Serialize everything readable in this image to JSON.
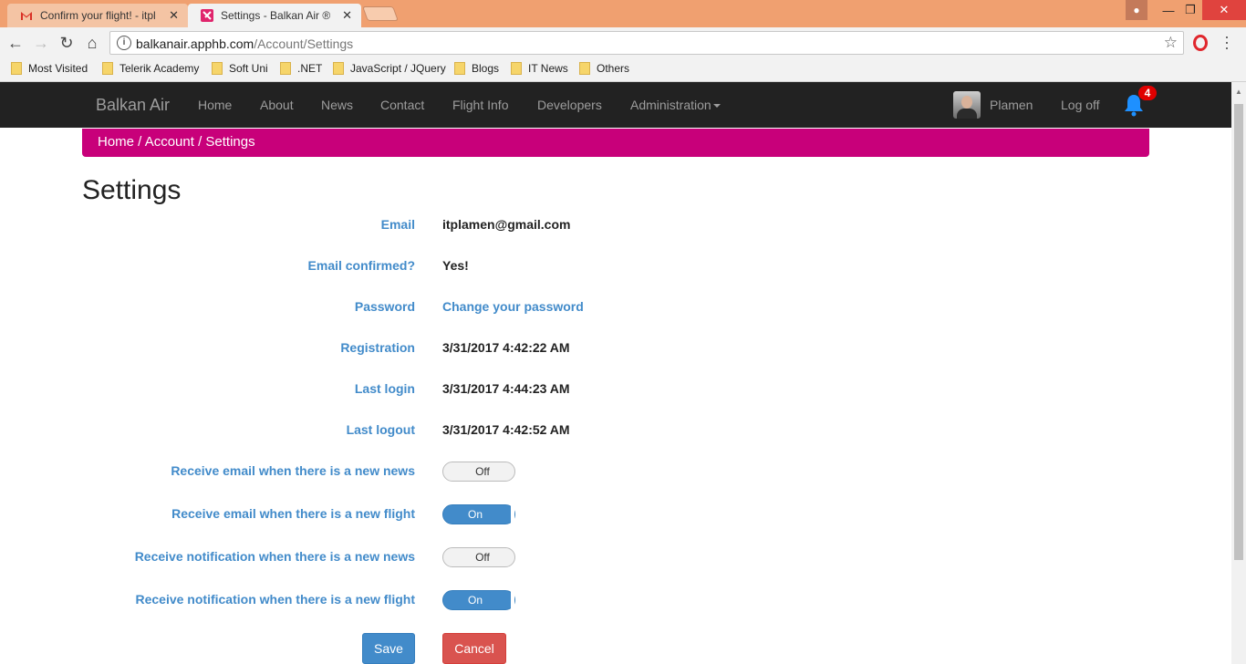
{
  "browser": {
    "tabs": [
      {
        "title": "Confirm your flight! - itpl",
        "active": false
      },
      {
        "title": "Settings - Balkan Air ®",
        "active": true
      }
    ],
    "url_host": "balkanair.apphb.com",
    "url_path": "/Account/Settings",
    "bookmarks": [
      "Most Visited",
      "Telerik Academy",
      "Soft Uni",
      ".NET",
      "JavaScript / JQuery",
      "Blogs",
      "IT News",
      "Others"
    ]
  },
  "navbar": {
    "brand": "Balkan Air",
    "links": [
      "Home",
      "About",
      "News",
      "Contact",
      "Flight Info",
      "Developers",
      "Administration"
    ],
    "user": "Plamen",
    "logoff": "Log off",
    "notification_count": "4"
  },
  "breadcrumb": {
    "home": "Home",
    "account": "Account",
    "current": "Settings",
    "sep": " / "
  },
  "page_title": "Settings",
  "fields": [
    {
      "label": "Email",
      "value": "itplamen@gmail.com"
    },
    {
      "label": "Email confirmed?",
      "value": "Yes!"
    },
    {
      "label": "Password",
      "value": "Change your password"
    },
    {
      "label": "Registration",
      "value": "3/31/2017 4:42:22 AM"
    },
    {
      "label": "Last login",
      "value": "3/31/2017 4:44:23 AM"
    },
    {
      "label": "Last logout",
      "value": "3/31/2017 4:42:52 AM"
    }
  ],
  "toggles": [
    {
      "label": "Receive email when there is a new news",
      "state": "Off"
    },
    {
      "label": "Receive email when there is a new flight",
      "state": "On"
    },
    {
      "label": "Receive notification when there is a new news",
      "state": "Off"
    },
    {
      "label": "Receive notification when there is a new flight",
      "state": "On"
    }
  ],
  "buttons": {
    "save": "Save",
    "cancel": "Cancel"
  },
  "colors": {
    "navbar": "#222222",
    "breadcrumb": "#c8007a",
    "primary": "#428bca",
    "danger": "#d9534f"
  }
}
